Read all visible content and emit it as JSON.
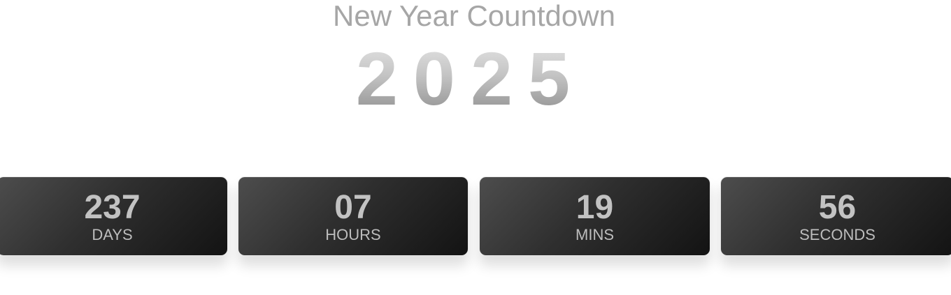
{
  "header": {
    "title": "New Year Countdown",
    "year": "2025"
  },
  "countdown": [
    {
      "value": "237",
      "label": "DAYS"
    },
    {
      "value": "07",
      "label": "HOURS"
    },
    {
      "value": "19",
      "label": "MINS"
    },
    {
      "value": "56",
      "label": "SECONDS"
    }
  ],
  "colors": {
    "title_text": "#a6a6a6",
    "box_dark": "#131313",
    "box_light": "#4d4d4d",
    "box_text": "#c2c2c2"
  }
}
